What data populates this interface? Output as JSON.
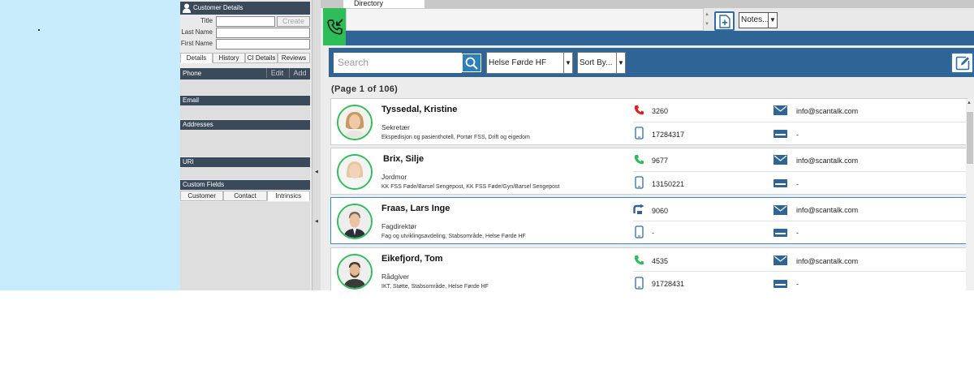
{
  "customer_panel": {
    "title": "Customer Details",
    "fields": [
      {
        "label": "Title",
        "value": ""
      },
      {
        "label": "Last Name",
        "value": ""
      },
      {
        "label": "First Name",
        "value": ""
      }
    ],
    "create_label": "Create",
    "tabs": [
      "Details",
      "History",
      "CI Details",
      "Reviews"
    ],
    "phone_header": "Phone",
    "edit_label": "Edit",
    "add_label": "Add",
    "email_header": "Email",
    "addresses_header": "Addresses",
    "uri_header": "URI",
    "custom_fields_header": "Custom Fields",
    "custom_tabs": [
      "Customer",
      "Contact",
      "Intrinsics"
    ]
  },
  "main": {
    "tab_label": "Directory",
    "notes_label": "Notes...",
    "search_placeholder": "Search",
    "organization": "Helse Førde HF",
    "sort_label": "Sort By...",
    "page_info": "(Page 1 of 106)",
    "contacts": [
      {
        "name": "Tyssedal, Kristine",
        "title": "Sekretær",
        "dept": "Ekspedisjon og pasienthotell, Portør FSS, Drift og eigedom",
        "ext": "3260",
        "mobile": "17284317",
        "email": "info@scantalk.com",
        "fax": "-",
        "status": "busy"
      },
      {
        "name": "Brix, Silje",
        "title": "Jordmor",
        "dept": "KK FSS Føde/Barsel Sengepost, KK FSS Føde/Gyn/Barsel Sengepost",
        "ext": "9677",
        "mobile": "13150221",
        "email": "info@scantalk.com",
        "fax": "-",
        "status": "available"
      },
      {
        "name": "Fraas, Lars Inge",
        "title": "Fagdirektør",
        "dept": "Fag og utviklingsavdeling, Stabsområde, Helse Førde HF",
        "ext": "9060",
        "mobile": "-",
        "email": "info@scantalk.com",
        "fax": "-",
        "status": "forward"
      },
      {
        "name": "Eikefjord, Tom",
        "title": "Rådgiver",
        "dept": "IKT, Støtte, Stabsområde, Helse Førde HF",
        "ext": "4535",
        "mobile": "91728431",
        "email": "info@scantalk.com",
        "fax": "-",
        "status": "available"
      }
    ]
  },
  "colors": {
    "accent_blue": "#2e6496",
    "green": "#2ebd59",
    "busy_red": "#e02020",
    "panel_header": "#3b4a5b"
  }
}
